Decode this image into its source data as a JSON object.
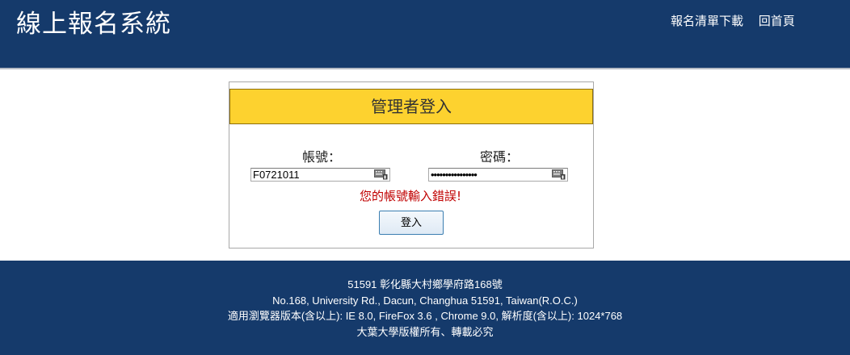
{
  "header": {
    "site_title": "線上報名系統",
    "nav": [
      "報名清單下載",
      "回首頁"
    ]
  },
  "login": {
    "title": "管理者登入",
    "account_label": "帳號：",
    "password_label": "密碼：",
    "account_value": "F0721011",
    "password_masked": "••••••••••••••••",
    "error": "您的帳號輸入錯誤!",
    "submit_label": "登入"
  },
  "footer": {
    "lines": [
      "51591 彰化縣大村鄉學府路168號",
      "No.168, University Rd., Dacun, Changhua 51591, Taiwan(R.O.C.)",
      "適用瀏覽器版本(含以上): IE 8.0, FireFox 3.6 , Chrome 9.0, 解析度(含以上): 1024*768",
      "大葉大學版權所有、轉載必究"
    ]
  },
  "colors": {
    "header_bg": "#153a6b",
    "title_bar": "#fdd22f",
    "error": "#c00000"
  },
  "icons": [
    "virtual-keyboard-icon"
  ]
}
